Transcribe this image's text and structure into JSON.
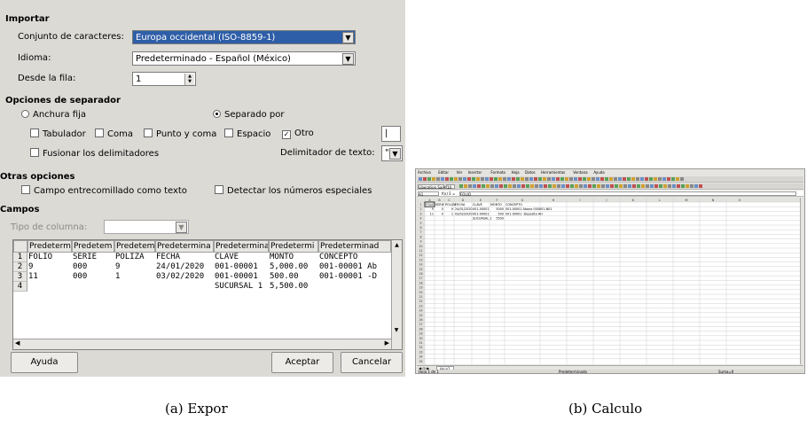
{
  "dialog": {
    "import_header": "Importar",
    "charset_label": "Conjunto de caracteres:",
    "charset_value": "Europa occidental (ISO-8859-1)",
    "language_label": "Idioma:",
    "language_value": "Predeterminado - Español (México)",
    "from_row_label": "Desde la fila:",
    "from_row_value": "1",
    "separator_header": "Opciones de separador",
    "fixed_width": "Anchura fija",
    "separated_by": "Separado por",
    "tab": "Tabulador",
    "comma": "Coma",
    "semicolon": "Punto y coma",
    "space": "Espacio",
    "other": "Otro",
    "other_value": "|",
    "merge_delims": "Fusionar los delimitadores",
    "text_delim_label": "Delimitador de texto:",
    "text_delim_value": "\"",
    "other_options_header": "Otras opciones",
    "quoted_as_text": "Campo entrecomillado como texto",
    "detect_special": "Detectar los números especiales",
    "fields_header": "Campos",
    "column_type_label": "Tipo de columna:",
    "column_type_value": "",
    "grid_headers": [
      "Predeterm",
      "Predetem",
      "Predetem",
      "Predetermina",
      "Predetermina",
      "Predetermi",
      "Predeterminad"
    ],
    "grid_row_nums": [
      "1",
      "2",
      "3",
      "4"
    ],
    "grid_rows": [
      [
        "FOLIO",
        "SERIE",
        "POLIZA",
        "FECHA",
        "CLAVE",
        "MONTO",
        "CONCEPTO"
      ],
      [
        "9",
        "000",
        "9",
        "24/01/2020",
        "001-00001",
        "5,000.00",
        "001-00001 Ab"
      ],
      [
        "11",
        "000",
        "1",
        "03/02/2020",
        "001-00001",
        "500.00",
        "001-00001 -D"
      ],
      [
        "",
        "",
        "",
        "",
        "SUCURSAL 1",
        "5,500.00",
        ""
      ]
    ],
    "help_button": "Ayuda",
    "ok_button": "Aceptar",
    "cancel_button": "Cancelar"
  },
  "calc": {
    "menu": [
      "Archivo",
      "Editar",
      "Ver",
      "Insertar",
      "Formato",
      "Hoja",
      "Datos",
      "Herramientas",
      "Ventana",
      "Ayuda"
    ],
    "font_name": "Liberation Sans",
    "font_size": "10",
    "cell_ref": "A1",
    "formula_value": "FOLIO",
    "col_headers": [
      "A",
      "B",
      "C",
      "D",
      "E",
      "F",
      "G",
      "H",
      "I",
      "J",
      "K",
      "L",
      "M",
      "N",
      "O"
    ],
    "rows": [
      [
        "FOLIO",
        "SERIE",
        "POLIZA",
        "FECHA",
        "CLAVE",
        "MONTO",
        "CONCEPTO"
      ],
      [
        "9",
        "0",
        "9",
        "24/01/2020",
        "001-00001",
        "5000",
        "001-00001 Abono 000001-N01"
      ],
      [
        "11",
        "0",
        "1",
        "03/02/2020",
        "001-00001",
        "500",
        "001-00001 -Deposito AH"
      ],
      [
        "",
        "",
        "",
        "",
        "SUCURSAL 1",
        "5500",
        ""
      ]
    ],
    "sheet_tab": "Hoja1",
    "status_left": "Hoja 1 de 1",
    "status_mid": "Predeterminado",
    "status_right": "Suma=0"
  },
  "captions": {
    "a": "(a) Expor",
    "b": "(b) Calculo"
  }
}
